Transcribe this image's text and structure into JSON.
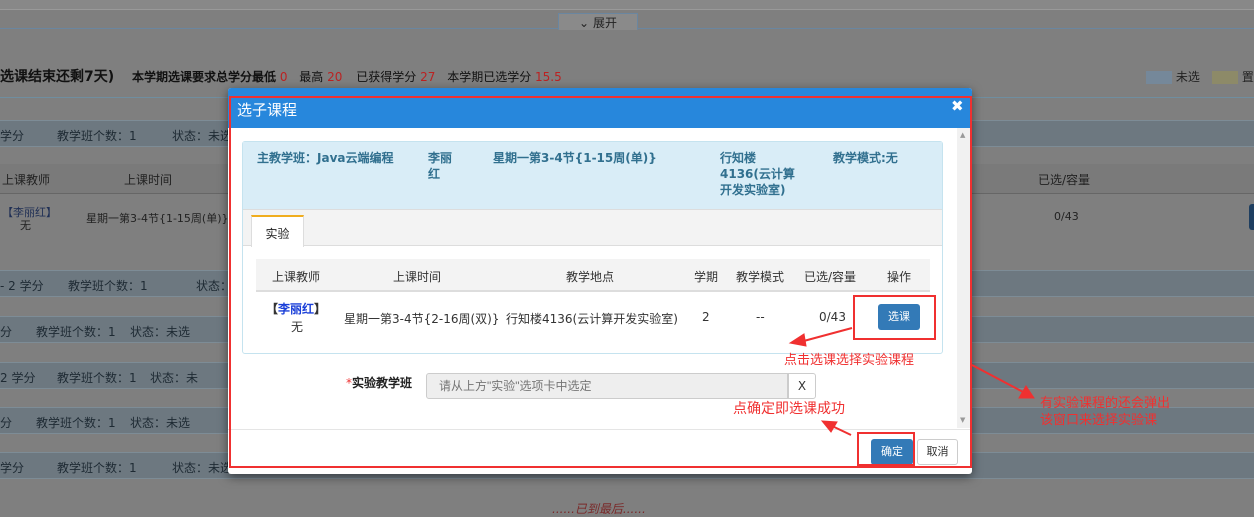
{
  "background": {
    "expand_label": "展开",
    "countdown": "选课结束还剩7天)",
    "requirement_label": "本学期选课要求总学分最低",
    "min_credits": "0",
    "max_label": "最高",
    "max_credits": "20",
    "earned_label": "已获得学分",
    "earned_credits": "27",
    "selected_label": "本学期已选学分",
    "selected_credits": "15.5",
    "legend_unselected": "未选",
    "legend_selected": "置",
    "header_teacher": "上课教师",
    "header_time": "上课时间",
    "header_capacity": "已选/容量",
    "row_teacher": "【李丽红】",
    "row_teacher_sub": "无",
    "row_time": "星期一第3-4节{1-15周(单)}",
    "row_capacity": "0/43",
    "bars": [
      {
        "credit": "学分",
        "count": "教学班个数：1",
        "status": "状态：未选"
      },
      {
        "credit": "- 2 学分",
        "count": "教学班个数：1",
        "status": "状态："
      },
      {
        "credit": "分",
        "count": "教学班个数：1",
        "status": "状态：未选"
      },
      {
        "credit": "2 学分",
        "count": "教学班个数：1",
        "status": "状态：未"
      },
      {
        "credit": "分",
        "count": "教学班个数：1",
        "status": "状态：未选"
      },
      {
        "credit": "学分",
        "count": "教学班个数：1",
        "status": "状态：未选"
      }
    ],
    "end_text": "......已到最后......"
  },
  "modal": {
    "title": "选子课程",
    "main_class": "主教学班：Java云端编程",
    "main_teacher": "李丽红",
    "main_time": "星期一第3-4节{1-15周(单)}",
    "main_location": "行知楼4136(云计算开发实验室)",
    "main_mode": "教学模式:无",
    "tab": "实验",
    "columns": [
      "上课教师",
      "上课时间",
      "教学地点",
      "学期",
      "教学模式",
      "已选/容量",
      "操作"
    ],
    "row": {
      "teacher": "李丽红",
      "bracket_l": "【",
      "bracket_r": "】",
      "teacher_sub": "无",
      "time": "星期一第3-4节{2-16周(双)}",
      "location": "行知楼4136(云计算开发实验室)",
      "term": "2",
      "mode": "--",
      "capacity": "0/43",
      "action": "选课"
    },
    "field_required": "*",
    "field_label": "实验教学班",
    "field_placeholder": "请从上方\"实验\"选项卡中选定",
    "clear": "X",
    "confirm": "确定",
    "cancel": "取消"
  },
  "annotations": {
    "select": "点击选课选择实验课程",
    "confirm": "点确定即选课成功",
    "popup_line1": "有实验课程的还会弹出",
    "popup_line2": "该窗口来选择实验课"
  }
}
